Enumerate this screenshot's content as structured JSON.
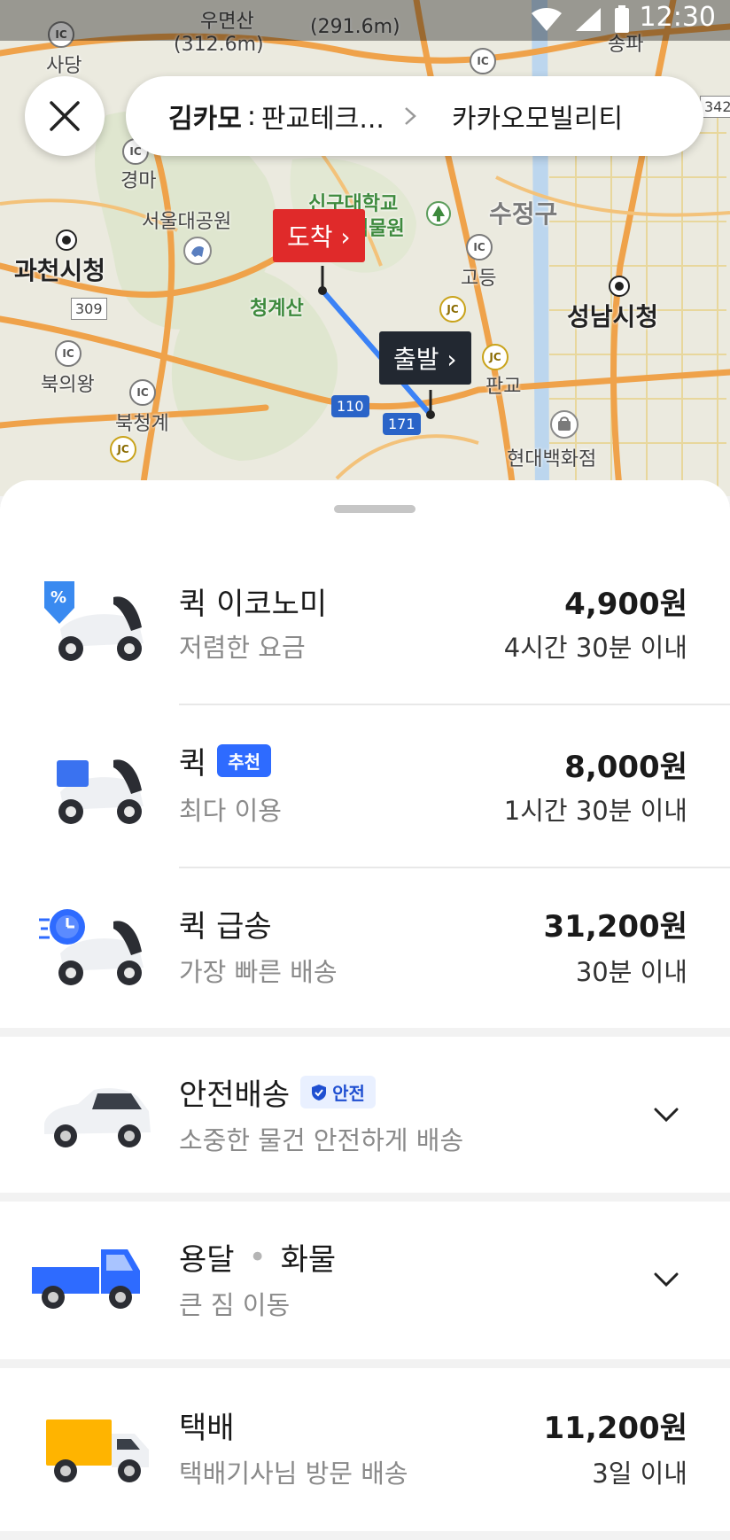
{
  "status_bar": {
    "time": "12:30"
  },
  "map": {
    "labels": {
      "umyeonsan": "우면산",
      "umyeonsan_height": "(312.6m)",
      "peak2": "(291.6m)",
      "sadang": "사당",
      "gyeongma": "경마",
      "seoul_grand_park": "서울대공원",
      "gwacheon_city_hall": "과천시청",
      "singu_univ": "신구대학교",
      "botanical": "식물원",
      "sujeong_gu": "수정구",
      "godeung": "고등",
      "seongnam_city_hall": "성남시청",
      "cheonggyesan": "청계산",
      "bukuiwang": "북의왕",
      "bukcheonggye": "북청계",
      "pangyo": "판교",
      "hyundai_dept": "현대백화점",
      "songpa": "송파",
      "road_309": "309",
      "road_342": "342",
      "road_110": "110",
      "road_171": "171",
      "ic": "IC",
      "jc": "JC"
    },
    "pin_arrive": "도착",
    "pin_depart": "출발"
  },
  "route_pill": {
    "sender": "김카모",
    "separator": ":",
    "from": "판교테크...",
    "to": "카카오모빌리티"
  },
  "services": [
    {
      "title": "퀵 이코노미",
      "sub": "저렴한 요금",
      "price": "4,900원",
      "eta": "4시간 30분 이내"
    },
    {
      "title": "퀵",
      "badge": "추천",
      "sub": "최다 이용",
      "price": "8,000원",
      "eta": "1시간 30분 이내"
    },
    {
      "title": "퀵 급송",
      "sub": "가장 빠른 배송",
      "price": "31,200원",
      "eta": "30분 이내"
    },
    {
      "title": "안전배송",
      "badge": "안전",
      "sub": "소중한 물건 안전하게 배송"
    },
    {
      "title_a": "용달",
      "title_dot": "•",
      "title_b": "화물",
      "sub": "큰 짐 이동"
    },
    {
      "title": "택배",
      "sub": "택배기사님 방문 배송",
      "price": "11,200원",
      "eta": "3일 이내"
    }
  ],
  "colors": {
    "accent": "#2e6bff",
    "arrive": "#e02a2a",
    "depart": "#222831",
    "route": "#3b82f6"
  }
}
